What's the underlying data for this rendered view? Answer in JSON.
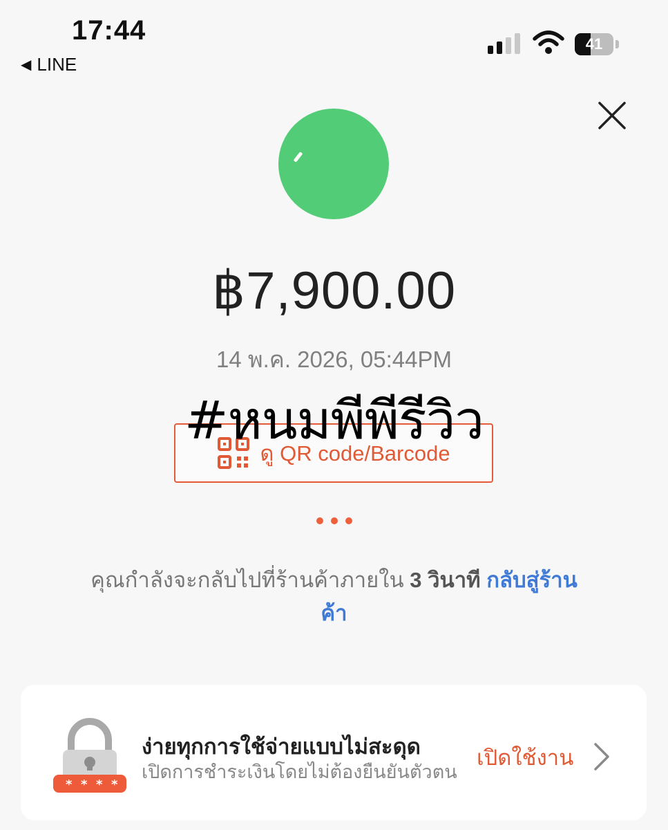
{
  "status_bar": {
    "time": "17:44",
    "back_app": "LINE",
    "battery": "41",
    "battery_level": 0.41,
    "signal_bars": 2
  },
  "payment": {
    "amount": "฿7,900.00",
    "datetime": "14 พ.ค. 2026, 05:44PM",
    "qr_button_label": "ดู QR code/Barcode"
  },
  "watermark": "#หนมพีพีรีวิว",
  "redirect": {
    "prefix": "คุณกำลังจะกลับไปที่ร้านค้าภายใน",
    "seconds": "3",
    "unit": "วินาที",
    "link": "กลับสู่ร้านค้า"
  },
  "promo_card": {
    "title": "ง่ายทุกการใช้จ่ายแบบไม่สะดุด",
    "subtitle": "เปิดการชำระเงินโดยไม่ต้องยืนยันตัวตน",
    "action": "เปิดใช้งาน"
  },
  "icons": [
    "back-icon",
    "signal-icon",
    "wifi-icon",
    "battery-icon",
    "close-icon",
    "success-icon",
    "qr-code-icon",
    "lock-icon",
    "chevron-right-icon"
  ],
  "colors": {
    "success_green": "#52cc76",
    "accent_orange": "#e05a35",
    "link_blue": "#3f7ad6",
    "background": "#f7f7f7"
  }
}
